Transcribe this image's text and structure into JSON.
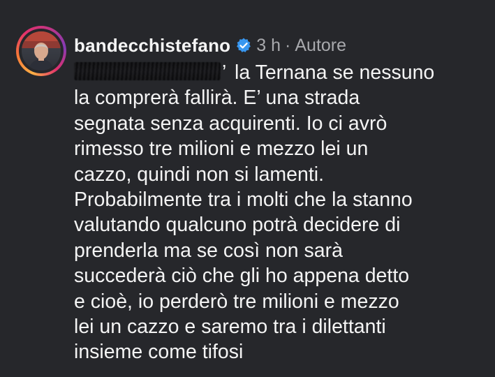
{
  "comment": {
    "username": "bandecchistefano",
    "verified_icon": "verified-badge-icon",
    "time": "3 h",
    "separator": "·",
    "role": "Autore",
    "redaction_tail": "’",
    "lines": [
      "la Ternana se nessuno",
      "la comprerà fallirà. E’ una strada",
      "segnata senza acquirenti. Io ci avrò",
      "rimesso tre milioni e mezzo lei un",
      "cazzo, quindi non si lamenti.",
      "Probabilmente tra i molti che la stanno",
      "valutando qualcuno potrà decidere di",
      "prenderla ma se così non sarà",
      "succederà ciò che gli ho appena detto",
      "e cioè, io perderò tre milioni e mezzo",
      "lei un cazzo e saremo tra i dilettanti",
      "insieme come tifosi"
    ]
  },
  "colors": {
    "background": "#26272b",
    "text": "#f4f4f4",
    "meta": "#a8a9ad",
    "verified": "#3897f0"
  }
}
